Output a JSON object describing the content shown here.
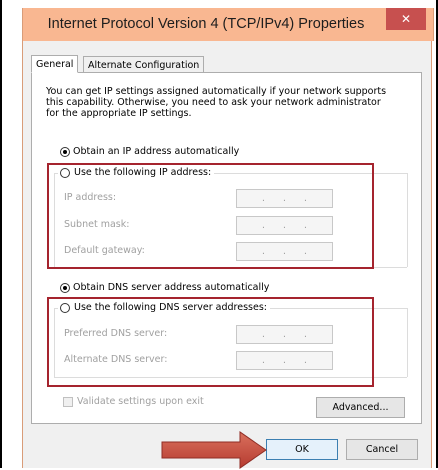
{
  "window": {
    "title": "Internet Protocol Version 4 (TCP/IPv4) Properties",
    "close_glyph": "✕"
  },
  "tabs": [
    {
      "label": "General",
      "active": true
    },
    {
      "label": "Alternate Configuration",
      "active": false
    }
  ],
  "general": {
    "description": "You can get IP settings assigned automatically if your network supports this capability. Otherwise, you need to ask your network administrator for the appropriate IP settings.",
    "description_lines": [
      "You can get IP settings assigned automatically if your network supports",
      "this capability. Otherwise, you need to ask your network administrator",
      "for the appropriate IP settings."
    ],
    "ip_auto_label": "Obtain an IP address automatically",
    "ip_auto_selected": true,
    "ip_manual_label": "Use the following IP address:",
    "ip_manual_selected": false,
    "ip_fields": [
      {
        "label": "IP address:",
        "value": ". . ."
      },
      {
        "label": "Subnet mask:",
        "value": ". . ."
      },
      {
        "label": "Default gateway:",
        "value": ". . ."
      }
    ],
    "dns_auto_label": "Obtain DNS server address automatically",
    "dns_auto_selected": true,
    "dns_manual_label": "Use the following DNS server addresses:",
    "dns_manual_selected": false,
    "dns_fields": [
      {
        "label": "Preferred DNS server:",
        "value": ". . ."
      },
      {
        "label": "Alternate DNS server:",
        "value": ". . ."
      }
    ],
    "validate_label": "Validate settings upon exit",
    "validate_checked": false,
    "advanced_label": "Advanced..."
  },
  "buttons": {
    "ok_label": "OK",
    "cancel_label": "Cancel"
  },
  "colors": {
    "titlebar": "#f9b791",
    "close_button": "#c7504f",
    "highlight_box": "#a5242e",
    "arrow": "#c24a3e"
  },
  "icons": {
    "close": "close-icon",
    "arrow": "arrow-right-icon"
  }
}
